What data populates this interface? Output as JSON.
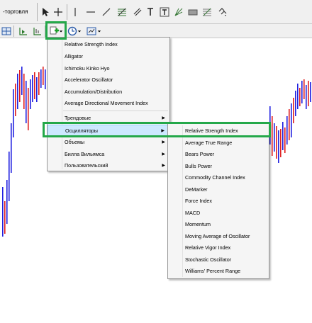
{
  "toolbar": {
    "title": "-торговля",
    "tools": [
      "cursor-icon",
      "crosshair-icon",
      "vertical-line-icon",
      "horizontal-line-icon",
      "trendline-icon",
      "fibonacci-icon",
      "text-icon",
      "text-label-icon",
      "rectangle-icon",
      "channel-icon",
      "more-shapes-icon"
    ]
  },
  "indicators_menu": {
    "items": [
      {
        "label": "Relative Strength Index"
      },
      {
        "label": "Alligator"
      },
      {
        "label": "Ichimoku Kinko Hyo"
      },
      {
        "label": "Accelerator Oscillator"
      },
      {
        "label": "Accumulation/Distribution"
      },
      {
        "label": "Average Directional Movement Index"
      }
    ],
    "categories": [
      {
        "label": "Трендовые"
      },
      {
        "label": "Осцилляторы"
      },
      {
        "label": "Объемы"
      },
      {
        "label": "Билла Вильямса"
      },
      {
        "label": "Пользовательский"
      }
    ]
  },
  "oscillators_menu": {
    "items": [
      {
        "label": "Relative Strength Index"
      },
      {
        "label": "Average True Range"
      },
      {
        "label": "Bears Power"
      },
      {
        "label": "Bulls Power"
      },
      {
        "label": "Commodity Channel Index"
      },
      {
        "label": "DeMarker"
      },
      {
        "label": "Force Index"
      },
      {
        "label": "MACD"
      },
      {
        "label": "Momentum"
      },
      {
        "label": "Moving Average of Oscillator"
      },
      {
        "label": "Relative Vigor Index"
      },
      {
        "label": "Stochastic Oscillator"
      },
      {
        "label": "Williams' Percent Range"
      }
    ]
  },
  "colors": {
    "highlight_box": "#24a84a",
    "bull_candle": "#2020e0",
    "bear_candle": "#e02020",
    "selected_item": "#cce8ff"
  }
}
